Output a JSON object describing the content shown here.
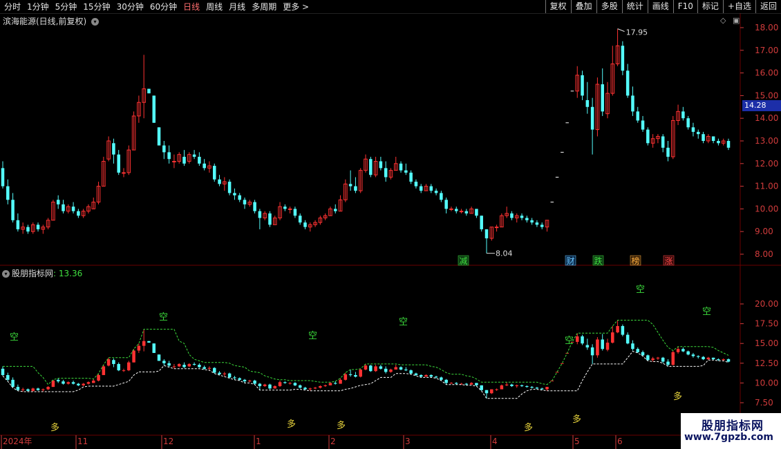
{
  "toolbar": {
    "periods": [
      "分时",
      "1分钟",
      "5分钟",
      "15分钟",
      "30分钟",
      "60分钟",
      "日线",
      "周线",
      "月线",
      "多周期",
      "更多 >"
    ],
    "active_period": "日线",
    "right_buttons": [
      "复权",
      "叠加",
      "多股",
      "统计",
      "画线",
      "F10",
      "标记",
      "+自选",
      "返回"
    ]
  },
  "main_panel": {
    "stock_title": "滨海能源(日线,前复权)",
    "title_icon": "chevron-down-icon",
    "high_label": "17.95",
    "low_label": "8.04",
    "current_price": "14.28",
    "price_axis_labels": [
      "18.00",
      "17.00",
      "16.00",
      "15.00",
      "14.00",
      "13.00",
      "12.00",
      "11.00",
      "10.00",
      "9.00",
      "8.00"
    ],
    "price_axis_values": [
      18,
      17,
      16,
      15,
      14,
      13,
      12,
      11,
      10,
      9,
      8
    ],
    "badges": [
      {
        "text": "减",
        "color": "#40e040",
        "bg": "#0d3a12"
      },
      {
        "text": "财",
        "color": "#6cc8ff",
        "bg": "#0b2a4a"
      },
      {
        "text": "跌",
        "color": "#40e040",
        "bg": "#0d3a12"
      },
      {
        "text": "榜",
        "color": "#ffb040",
        "bg": "#3a2208"
      },
      {
        "text": "涨",
        "color": "#ff4a4a",
        "bg": "#3a0a0a"
      }
    ]
  },
  "indicator_panel": {
    "title": "股朋指标网",
    "value_label": ": 13.36",
    "axis_labels": [
      "20.00",
      "17.50",
      "15.00",
      "12.50",
      "10.00",
      "7.50"
    ],
    "axis_values": [
      20,
      17.5,
      15,
      12.5,
      10,
      7.5
    ],
    "kong_labels": [
      "空",
      "空",
      "空",
      "空",
      "空",
      "空",
      "空"
    ],
    "duo_labels": [
      "多",
      "多",
      "多",
      "多",
      "多",
      "多"
    ]
  },
  "date_axis": {
    "labels": [
      "2024年",
      "11",
      "12",
      "1",
      "2",
      "3",
      "4",
      "5",
      "6"
    ]
  },
  "watermark": {
    "line1": "股朋指标网",
    "line2": "www.7gpzb.com"
  },
  "colors": {
    "up": "#ff3232",
    "down": "#54fcfc",
    "grid": "#6a0000",
    "axis_text": "#d23c3c",
    "support_line": "#ffffff",
    "resistance_line": "#3cdc3c",
    "duo": "#e6d23c",
    "kong": "#3cdc3c"
  },
  "chart_data": {
    "type": "candlestick",
    "ylim": [
      7.6,
      18.4
    ],
    "indicator_ylim": [
      6,
      22.5
    ],
    "dates": [
      "2024-10",
      "2024-11",
      "2024-12",
      "2025-01",
      "2025-02",
      "2025-03",
      "2025-04",
      "2025-05",
      "2025-06"
    ],
    "ohlc": [
      [
        11.8,
        12.1,
        10.9,
        11.0
      ],
      [
        11.0,
        11.3,
        10.2,
        10.4
      ],
      [
        10.4,
        10.7,
        9.4,
        9.5
      ],
      [
        9.5,
        9.8,
        9.0,
        9.1
      ],
      [
        9.1,
        9.4,
        8.9,
        9.2
      ],
      [
        9.2,
        9.3,
        8.9,
        9.0
      ],
      [
        9.0,
        9.4,
        8.9,
        9.3
      ],
      [
        9.3,
        9.4,
        9.0,
        9.1
      ],
      [
        9.1,
        9.3,
        8.9,
        9.2
      ],
      [
        9.2,
        9.6,
        9.1,
        9.5
      ],
      [
        9.5,
        10.4,
        9.5,
        10.3
      ],
      [
        10.4,
        10.6,
        10.0,
        10.2
      ],
      [
        10.2,
        10.4,
        9.8,
        9.9
      ],
      [
        9.9,
        10.2,
        9.8,
        10.1
      ],
      [
        10.1,
        10.3,
        9.8,
        9.9
      ],
      [
        9.9,
        10.0,
        9.6,
        9.7
      ],
      [
        9.7,
        10.0,
        9.6,
        9.9
      ],
      [
        9.9,
        10.2,
        9.8,
        10.1
      ],
      [
        10.0,
        10.5,
        10.0,
        10.3
      ],
      [
        10.3,
        11.2,
        10.2,
        11.0
      ],
      [
        11.0,
        12.3,
        11.0,
        12.1
      ],
      [
        12.2,
        13.2,
        12.1,
        13.0
      ],
      [
        12.9,
        13.1,
        12.0,
        12.4
      ],
      [
        12.4,
        12.6,
        11.5,
        11.6
      ],
      [
        11.6,
        11.8,
        11.4,
        11.6
      ],
      [
        11.6,
        12.8,
        11.5,
        12.6
      ],
      [
        12.6,
        14.3,
        12.6,
        14.1
      ],
      [
        14.1,
        15.0,
        13.8,
        14.7
      ],
      [
        14.7,
        16.8,
        14.0,
        15.3
      ],
      [
        15.3,
        15.3,
        15.1,
        15.1
      ],
      [
        15.0,
        15.0,
        13.8,
        13.8
      ],
      [
        13.6,
        13.6,
        12.8,
        12.8
      ],
      [
        12.8,
        13.0,
        12.2,
        12.5
      ],
      [
        12.5,
        12.8,
        12.0,
        12.2
      ],
      [
        12.1,
        12.4,
        11.8,
        12.1
      ],
      [
        12.1,
        12.5,
        12.0,
        12.4
      ],
      [
        12.3,
        12.6,
        11.9,
        12.0
      ],
      [
        12.1,
        12.5,
        12.0,
        12.4
      ],
      [
        12.4,
        12.6,
        12.2,
        12.3
      ],
      [
        12.3,
        12.5,
        11.9,
        12.0
      ],
      [
        12.0,
        12.2,
        11.7,
        11.8
      ],
      [
        11.8,
        12.1,
        11.6,
        11.9
      ],
      [
        11.9,
        12.0,
        11.2,
        11.3
      ],
      [
        11.3,
        11.5,
        11.0,
        11.1
      ],
      [
        11.1,
        11.4,
        10.8,
        11.2
      ],
      [
        11.2,
        11.3,
        10.6,
        10.7
      ],
      [
        10.7,
        10.9,
        10.4,
        10.6
      ],
      [
        10.6,
        10.7,
        10.3,
        10.4
      ],
      [
        10.4,
        10.5,
        10.0,
        10.2
      ],
      [
        10.2,
        10.4,
        10.1,
        10.3
      ],
      [
        10.3,
        10.4,
        9.8,
        9.9
      ],
      [
        9.9,
        10.0,
        9.1,
        9.6
      ],
      [
        9.6,
        9.9,
        9.5,
        9.8
      ],
      [
        9.8,
        9.9,
        9.2,
        9.3
      ],
      [
        9.3,
        9.7,
        9.3,
        9.6
      ],
      [
        9.6,
        10.3,
        9.5,
        10.1
      ],
      [
        10.1,
        10.2,
        9.9,
        10.0
      ],
      [
        10.0,
        10.1,
        9.8,
        10.0
      ],
      [
        10.0,
        10.1,
        9.6,
        9.7
      ],
      [
        9.7,
        9.8,
        9.3,
        9.4
      ],
      [
        9.4,
        9.5,
        9.1,
        9.2
      ],
      [
        9.2,
        9.4,
        9.0,
        9.3
      ],
      [
        9.3,
        9.5,
        9.2,
        9.4
      ],
      [
        9.4,
        9.7,
        9.3,
        9.6
      ],
      [
        9.6,
        9.8,
        9.5,
        9.7
      ],
      [
        9.7,
        10.1,
        9.7,
        10.0
      ],
      [
        10.0,
        10.2,
        9.8,
        9.9
      ],
      [
        9.9,
        10.6,
        9.9,
        10.4
      ],
      [
        10.4,
        11.3,
        10.3,
        11.1
      ],
      [
        11.1,
        11.7,
        10.8,
        11.0
      ],
      [
        11.0,
        11.4,
        10.7,
        10.8
      ],
      [
        10.8,
        11.8,
        10.7,
        11.7
      ],
      [
        11.7,
        12.4,
        11.6,
        12.2
      ],
      [
        12.2,
        12.3,
        11.4,
        11.5
      ],
      [
        11.5,
        12.3,
        11.4,
        12.1
      ],
      [
        12.1,
        12.3,
        11.7,
        11.8
      ],
      [
        11.8,
        12.1,
        11.2,
        11.4
      ],
      [
        11.4,
        11.8,
        11.3,
        11.7
      ],
      [
        11.7,
        12.3,
        11.7,
        12.0
      ],
      [
        12.0,
        12.1,
        11.6,
        11.7
      ],
      [
        11.7,
        12.0,
        11.5,
        11.6
      ],
      [
        11.6,
        11.7,
        11.1,
        11.2
      ],
      [
        11.2,
        11.3,
        10.9,
        11.0
      ],
      [
        11.0,
        11.1,
        10.7,
        10.8
      ],
      [
        10.8,
        11.1,
        10.8,
        11.0
      ],
      [
        11.0,
        11.1,
        10.7,
        10.8
      ],
      [
        10.8,
        10.9,
        10.6,
        10.7
      ],
      [
        10.7,
        10.8,
        10.3,
        10.4
      ],
      [
        10.4,
        10.5,
        9.8,
        10.0
      ],
      [
        10.0,
        10.1,
        9.9,
        10.0
      ],
      [
        10.0,
        10.1,
        9.8,
        9.9
      ],
      [
        9.9,
        10.0,
        9.8,
        9.9
      ],
      [
        9.9,
        10.0,
        9.7,
        9.8
      ],
      [
        9.8,
        10.1,
        9.8,
        10.0
      ],
      [
        10.0,
        10.0,
        9.6,
        9.7
      ],
      [
        9.7,
        9.7,
        9.0,
        9.1
      ],
      [
        9.1,
        9.1,
        8.04,
        8.7
      ],
      [
        8.7,
        9.2,
        8.6,
        9.2
      ],
      [
        9.2,
        9.3,
        9.0,
        9.2
      ],
      [
        9.2,
        9.8,
        9.2,
        9.7
      ],
      [
        9.7,
        10.1,
        9.6,
        9.8
      ],
      [
        9.8,
        9.9,
        9.5,
        9.6
      ],
      [
        9.6,
        9.8,
        9.4,
        9.7
      ],
      [
        9.7,
        9.8,
        9.5,
        9.6
      ],
      [
        9.6,
        9.7,
        9.4,
        9.5
      ],
      [
        9.5,
        9.6,
        9.3,
        9.4
      ],
      [
        9.4,
        9.5,
        9.2,
        9.3
      ],
      [
        9.3,
        9.4,
        9.1,
        9.2
      ],
      [
        9.2,
        9.5,
        9.0,
        9.5
      ],
      [
        10.3,
        10.3,
        10.3,
        10.3
      ],
      [
        11.4,
        11.4,
        11.4,
        11.4
      ],
      [
        12.5,
        12.5,
        12.5,
        12.5
      ],
      [
        13.8,
        13.8,
        13.8,
        13.8
      ],
      [
        15.2,
        15.2,
        15.2,
        15.2
      ],
      [
        15.2,
        16.3,
        14.9,
        15.9
      ],
      [
        15.9,
        16.1,
        14.8,
        15.0
      ],
      [
        14.8,
        15.6,
        14.2,
        14.5
      ],
      [
        14.5,
        14.9,
        12.4,
        13.5
      ],
      [
        13.5,
        15.8,
        13.2,
        15.5
      ],
      [
        15.5,
        16.2,
        14.1,
        14.3
      ],
      [
        14.2,
        15.6,
        14.0,
        15.1
      ],
      [
        15.1,
        17.2,
        15.0,
        16.4
      ],
      [
        16.4,
        17.95,
        16.3,
        17.2
      ],
      [
        17.2,
        17.4,
        15.9,
        16.1
      ],
      [
        16.1,
        16.4,
        14.9,
        15.0
      ],
      [
        15.0,
        15.4,
        14.1,
        14.3
      ],
      [
        14.3,
        14.5,
        13.8,
        13.9
      ],
      [
        13.9,
        14.1,
        13.4,
        13.5
      ],
      [
        13.5,
        13.6,
        12.8,
        12.9
      ],
      [
        12.9,
        13.3,
        12.7,
        13.1
      ],
      [
        13.1,
        13.3,
        12.9,
        13.2
      ],
      [
        13.2,
        13.3,
        12.5,
        12.7
      ],
      [
        12.7,
        13.0,
        12.1,
        12.3
      ],
      [
        12.3,
        14.1,
        12.2,
        13.9
      ],
      [
        13.9,
        14.6,
        13.7,
        14.3
      ],
      [
        14.3,
        14.5,
        13.9,
        14.0
      ],
      [
        14.0,
        14.1,
        13.5,
        13.6
      ],
      [
        13.6,
        13.8,
        13.2,
        13.4
      ],
      [
        13.4,
        13.5,
        13.1,
        13.3
      ],
      [
        13.3,
        13.4,
        12.9,
        13.0
      ],
      [
        13.0,
        13.3,
        12.9,
        13.2
      ],
      [
        13.2,
        13.2,
        12.9,
        13.0
      ],
      [
        13.0,
        13.1,
        12.8,
        12.9
      ],
      [
        12.9,
        13.1,
        12.8,
        13.0
      ],
      [
        13.0,
        13.1,
        12.6,
        12.7
      ]
    ]
  }
}
